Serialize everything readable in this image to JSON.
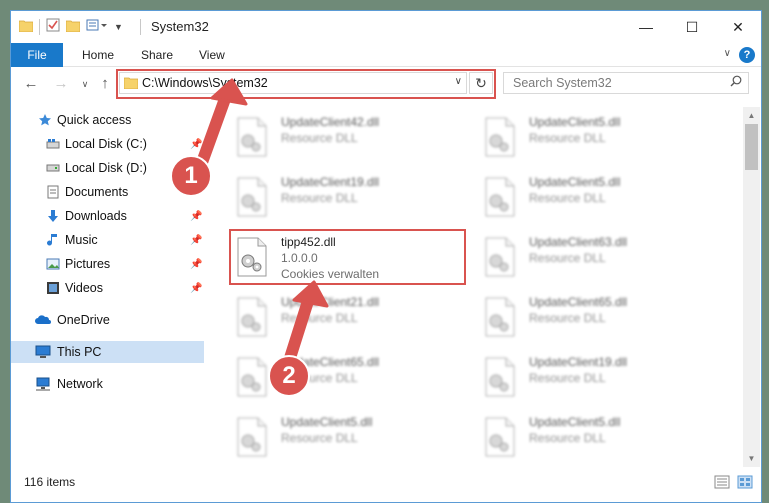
{
  "window": {
    "title": "System32",
    "controls": {
      "minimize": "—",
      "maximize": "☐",
      "close": "✕"
    }
  },
  "ribbon": {
    "tabs": [
      "File",
      "Home",
      "Share",
      "View"
    ]
  },
  "navigation": {
    "address_path": "C:\\Windows\\System32",
    "search_placeholder": "Search System32"
  },
  "sidebar": {
    "items": [
      {
        "label": "Quick access",
        "icon": "star-icon",
        "pinned": false
      },
      {
        "label": "Local Disk (C:)",
        "icon": "drive-icon",
        "pinned": true
      },
      {
        "label": "Local Disk (D:)",
        "icon": "drive-icon",
        "pinned": true
      },
      {
        "label": "Documents",
        "icon": "documents-icon",
        "pinned": true
      },
      {
        "label": "Downloads",
        "icon": "downloads-icon",
        "pinned": true
      },
      {
        "label": "Music",
        "icon": "music-icon",
        "pinned": true
      },
      {
        "label": "Pictures",
        "icon": "pictures-icon",
        "pinned": true
      },
      {
        "label": "Videos",
        "icon": "videos-icon",
        "pinned": true
      },
      {
        "label": "OneDrive",
        "icon": "onedrive-icon",
        "pinned": false
      },
      {
        "label": "This PC",
        "icon": "pc-icon",
        "pinned": false,
        "selected": true
      },
      {
        "label": "Network",
        "icon": "network-icon",
        "pinned": false
      }
    ]
  },
  "files": {
    "left": [
      {
        "name": "UpdateClient42.dll",
        "desc": "Resource DLL",
        "blurred": true
      },
      {
        "name": "UpdateClient19.dll",
        "desc": "Resource DLL",
        "blurred": true
      },
      {
        "name": "tipp452.dll",
        "desc": "1.0.0.0",
        "desc2": "Cookies verwalten",
        "blurred": false,
        "highlighted": true
      },
      {
        "name": "UpdateClient21.dll",
        "desc": "Resource DLL",
        "blurred": true
      },
      {
        "name": "UpdateClient65.dll",
        "desc": "Resource DLL",
        "blurred": true
      },
      {
        "name": "UpdateClient5.dll",
        "desc": "Resource DLL",
        "blurred": true
      }
    ],
    "right": [
      {
        "name": "UpdateClient5.dll",
        "desc": "Resource DLL",
        "blurred": true
      },
      {
        "name": "UpdateClient5.dll",
        "desc": "Resource DLL",
        "blurred": true
      },
      {
        "name": "UpdateClient63.dll",
        "desc": "Resource DLL",
        "blurred": true
      },
      {
        "name": "UpdateClient65.dll",
        "desc": "Resource DLL",
        "blurred": true
      },
      {
        "name": "UpdateClient19.dll",
        "desc": "Resource DLL",
        "blurred": true
      },
      {
        "name": "UpdateClient5.dll",
        "desc": "Resource DLL",
        "blurred": true
      }
    ]
  },
  "status": {
    "item_count": "116 items"
  },
  "annotations": {
    "step1": "1",
    "step2": "2",
    "color": "#d9534f"
  }
}
